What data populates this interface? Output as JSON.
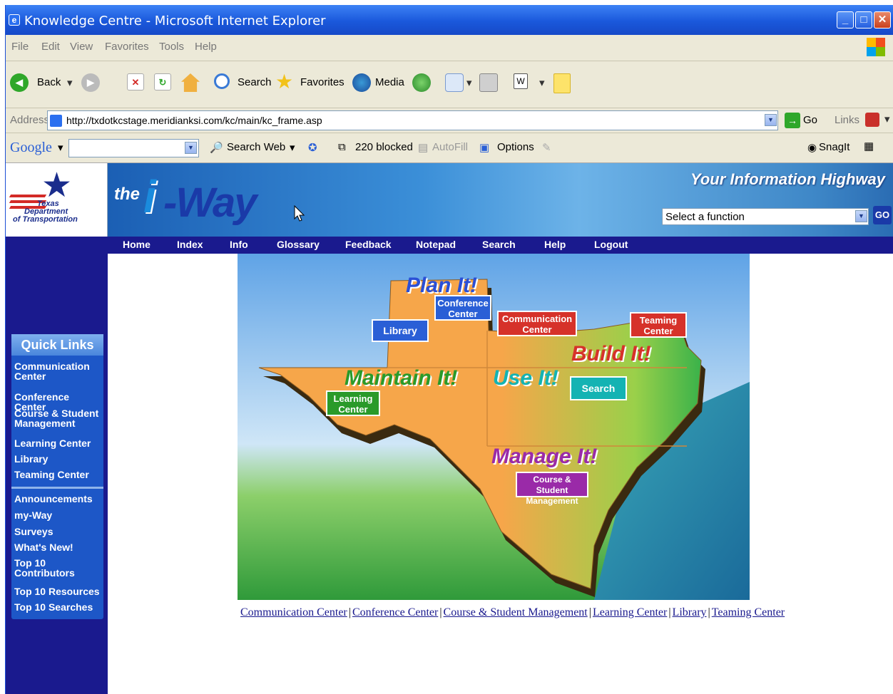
{
  "window": {
    "title": "Knowledge Centre - Microsoft Internet Explorer"
  },
  "menu": [
    "File",
    "Edit",
    "View",
    "Favorites",
    "Tools",
    "Help"
  ],
  "toolbar": {
    "back": "Back",
    "search": "Search",
    "favorites": "Favorites",
    "media": "Media"
  },
  "address": {
    "label": "Address",
    "url": "http://txdotkcstage.meridianksi.com/kc/main/kc_frame.asp",
    "go": "Go",
    "links": "Links"
  },
  "google": {
    "logo": "Google",
    "search_web": "Search Web",
    "blocked": "220 blocked",
    "autofill": "AutoFill",
    "options": "Options",
    "snagit": "SnagIt"
  },
  "site": {
    "logo_lines": [
      "Texas",
      "Department",
      "of Transportation"
    ],
    "brand_the": "the",
    "brand_i": "i",
    "brand_way": "-Way",
    "tagline": "Your Information Highway",
    "function_select": "Select a function",
    "go": "GO"
  },
  "nav": [
    "Home",
    "Index",
    "Info",
    "Glossary",
    "Feedback",
    "Notepad",
    "Search",
    "Help",
    "Logout"
  ],
  "quick_links": {
    "title": "Quick Links",
    "group1": [
      "Communication Center",
      "Conference Center",
      "Course & Student Management",
      "Learning Center",
      "Library",
      "Teaming Center"
    ],
    "group2": [
      "Announcements",
      "my-Way",
      "Surveys",
      "What's New!",
      "Top 10 Contributors",
      "Top 10 Resources",
      "Top 10 Searches"
    ]
  },
  "map": {
    "regions": [
      "Plan It!",
      "Build It!",
      "Maintain It!",
      "Use It!",
      "Manage It!"
    ],
    "signs": {
      "conference": "Conference Center",
      "library": "Library",
      "communication": "Communication Center",
      "teaming": "Teaming Center",
      "learning": "Learning Center",
      "search": "Search",
      "course": "Course & Student Management"
    },
    "colors": {
      "land": "#f6a64a",
      "library": "#2a5fd6",
      "conference": "#2a5fd6",
      "communication": "#d6322a",
      "teaming": "#d6322a",
      "learning": "#2a9a2a",
      "search": "#14b3b3",
      "course": "#9a2aa8"
    }
  },
  "footer_links": [
    "Communication Center",
    "Conference Center",
    "Course & Student Management",
    "Learning Center",
    "Library",
    "Teaming Center"
  ]
}
